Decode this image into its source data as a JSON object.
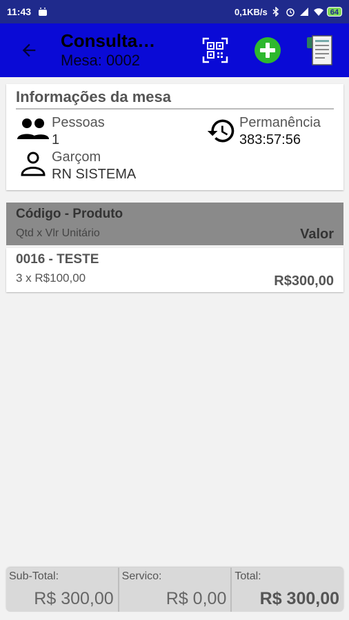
{
  "status_bar": {
    "time": "11:43",
    "net_speed": "0,1KB/s",
    "battery": "64"
  },
  "app_bar": {
    "title": "Consulta…",
    "subtitle": "Mesa: 0002",
    "icons": [
      "arrow-back-icon",
      "qr-code-icon",
      "add-circle-icon",
      "receipt-icon"
    ]
  },
  "info": {
    "heading": "Informações da mesa",
    "pessoas_label": "Pessoas",
    "pessoas_value": "1",
    "permanencia_label": "Permanência",
    "permanencia_value": "383:57:56",
    "garcom_label": "Garçom",
    "garcom_value": "RN SISTEMA"
  },
  "table": {
    "header_title": "Código - Produto",
    "header_sub": "Qtd x  Vlr Unitário",
    "header_valor": "Valor",
    "rows": [
      {
        "title": "0016 - TESTE",
        "sub": "3  x  R$100,00",
        "value": "R$300,00"
      }
    ]
  },
  "footer": {
    "subtotal_label": "Sub-Total:",
    "subtotal_value": "R$ 300,00",
    "servico_label": "Servico:",
    "servico_value": "R$ 0,00",
    "total_label": "Total:",
    "total_value": "R$ 300,00"
  },
  "colors": {
    "status_bar": "#1f2a8c",
    "app_bar": "#0a0ad6",
    "add_button": "#2eb82e",
    "table_header": "#8a8a8a"
  }
}
